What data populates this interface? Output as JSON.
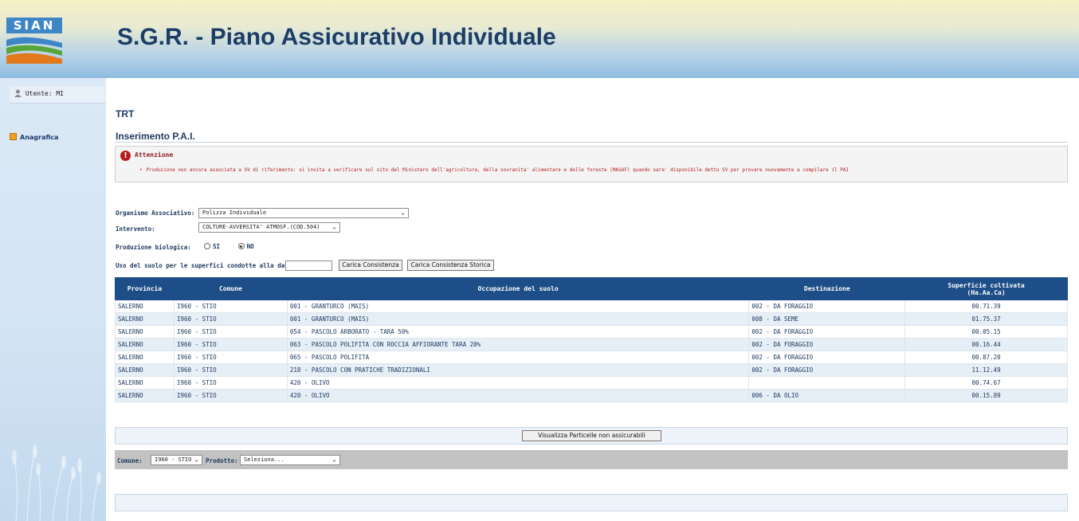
{
  "header": {
    "logo_text": "SIAN",
    "title": "S.G.R. - Piano Assicurativo Individuale"
  },
  "sidebar": {
    "user_label": "Utente: MI",
    "items": [
      {
        "label": "Anagrafica"
      }
    ]
  },
  "main": {
    "company": "TRT",
    "page_title": "Inserimento P.A.I."
  },
  "alert": {
    "title": "Attenzione",
    "message": "Produzione non ancora associata a SV di riferimento: si invita a verificare sul sito del Ministero dell'agricoltura, della sovranita' alimentare e delle foreste (MASAF) quando sara' disponibile detto SV per provare nuovamente a compilare il PAI"
  },
  "form": {
    "organismo_label": "Organismo Associativo:",
    "organismo_value": "Polizza Individuale",
    "intervento_label": "Intervento:",
    "intervento_value": "COLTURE-AVVERSITA' ATMOSF.(COD.504)",
    "biologica_label": "Produzione biologica:",
    "radio_si": "SI",
    "radio_no": "NO",
    "uso_suolo_label": "Uso del suolo per le superfici condotte alla data:",
    "uso_suolo_value": "",
    "carica_btn": "Carica Consistenza",
    "carica_storica_btn": "Carica Consistenza Storica"
  },
  "table": {
    "headers": {
      "provincia": "Provincia",
      "comune": "Comune",
      "occupazione": "Occupazione del suolo",
      "destinazione": "Destinazione",
      "superficie_1": "Superficie coltivata",
      "superficie_2": "(Ha.Aa.Ca)"
    },
    "rows": [
      {
        "provincia": "SALERNO",
        "comune": "I960 - STIO",
        "occupazione": "001 - GRANTURCO (MAIS)",
        "destinazione": "002 - DA FORAGGIO",
        "superficie": "00.71.39"
      },
      {
        "provincia": "SALERNO",
        "comune": "I960 - STIO",
        "occupazione": "001 - GRANTURCO (MAIS)",
        "destinazione": "008 - DA SEME",
        "superficie": "01.75.37"
      },
      {
        "provincia": "SALERNO",
        "comune": "I960 - STIO",
        "occupazione": "054 - PASCOLO ARBORATO - TARA 50%",
        "destinazione": "002 - DA FORAGGIO",
        "superficie": "00.05.15"
      },
      {
        "provincia": "SALERNO",
        "comune": "I960 - STIO",
        "occupazione": "063 - PASCOLO POLIFITA CON ROCCIA AFFIORANTE TARA 20%",
        "destinazione": "002 - DA FORAGGIO",
        "superficie": "00.16.44"
      },
      {
        "provincia": "SALERNO",
        "comune": "I960 - STIO",
        "occupazione": "065 - PASCOLO POLIFITA",
        "destinazione": "002 - DA FORAGGIO",
        "superficie": "00.87.20"
      },
      {
        "provincia": "SALERNO",
        "comune": "I960 - STIO",
        "occupazione": "218 - PASCOLO CON PRATICHE TRADIZIONALI",
        "destinazione": "002 - DA FORAGGIO",
        "superficie": "11.12.49"
      },
      {
        "provincia": "SALERNO",
        "comune": "I960 - STIO",
        "occupazione": "420 - OLIVO",
        "destinazione": "",
        "superficie": "00.74.67"
      },
      {
        "provincia": "SALERNO",
        "comune": "I960 - STIO",
        "occupazione": "420 - OLIVO",
        "destinazione": "006 - DA OLIO",
        "superficie": "00.15.89"
      }
    ]
  },
  "actions": {
    "visualizza_btn": "Visualizza Particelle non assicurabili"
  },
  "filter": {
    "comune_label": "Comune:",
    "comune_value": "I960 - STIO",
    "prodotto_label": "Prodotto:",
    "prodotto_value": "Seleziona..."
  },
  "colors": {
    "table_header": "#1d4e87",
    "alert_text": "#b42020",
    "title": "#1c3d66"
  }
}
